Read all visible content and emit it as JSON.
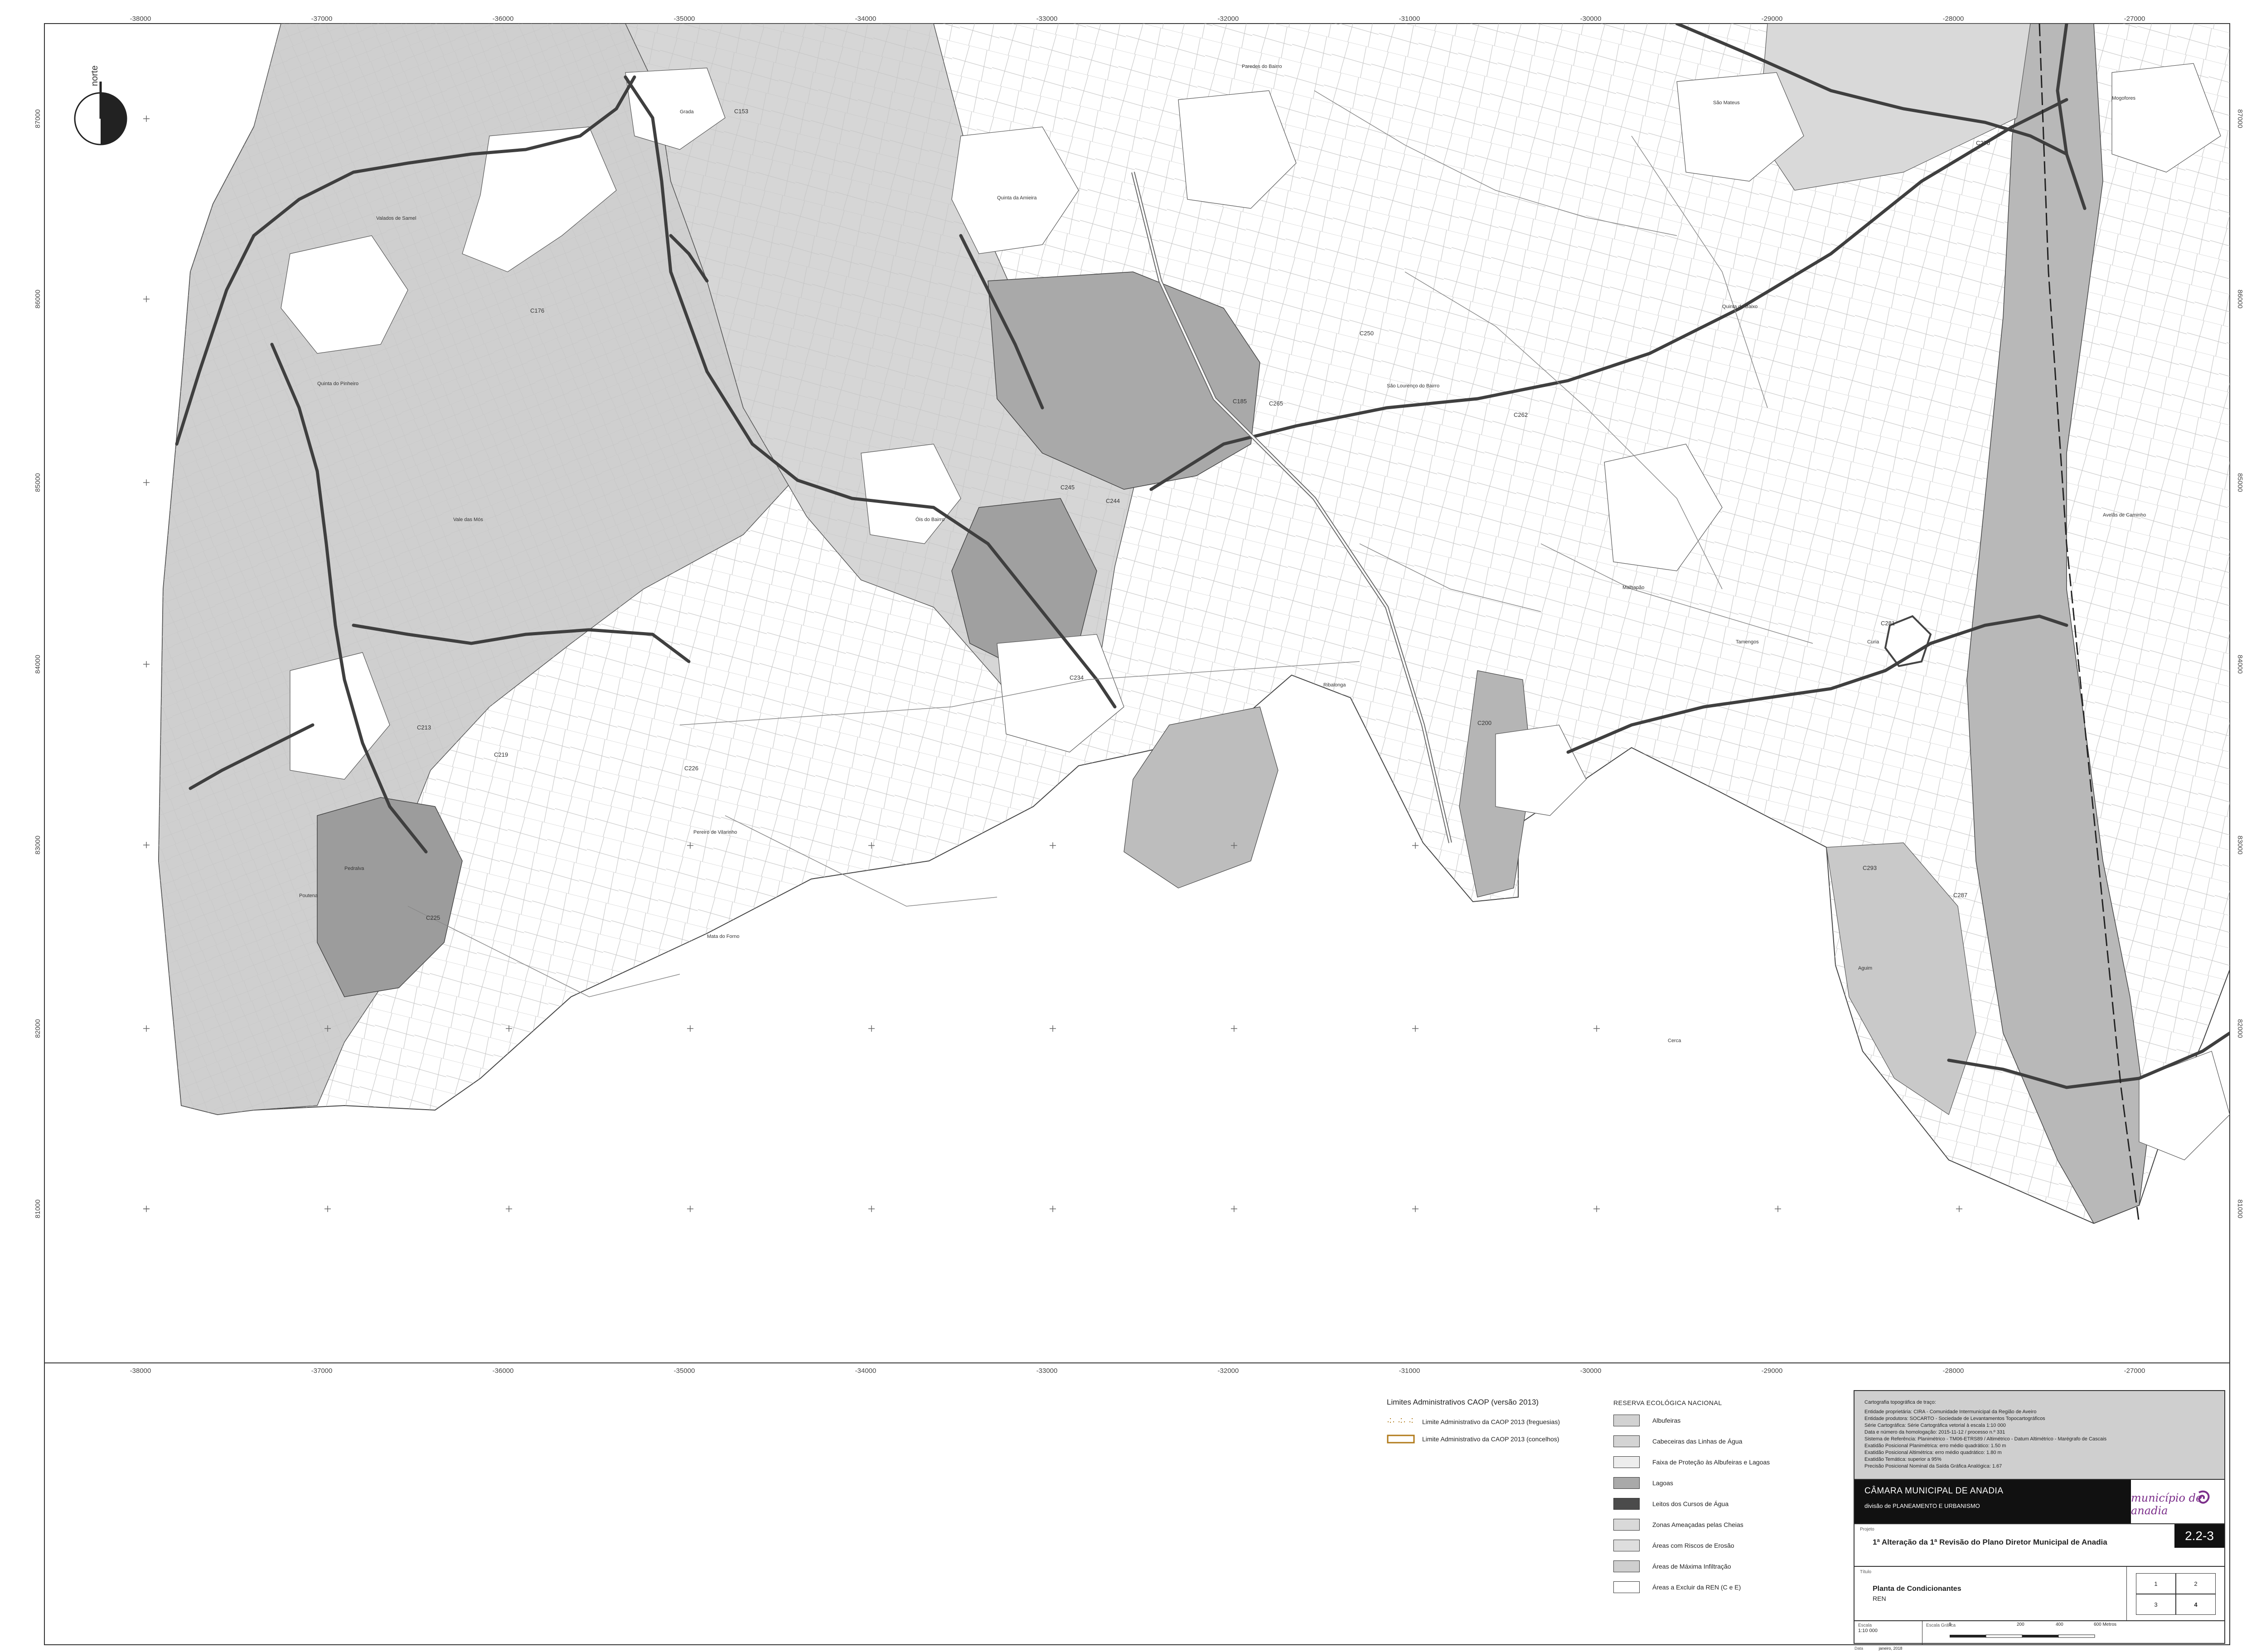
{
  "north_arrow": {
    "label": "norte"
  },
  "axes": {
    "x_ticks": [
      "-38000",
      "-37000",
      "-36000",
      "-35000",
      "-34000",
      "-33000",
      "-32000",
      "-31000",
      "-30000",
      "-29000",
      "-28000",
      "-27000"
    ],
    "y_ticks": [
      "87000",
      "86000",
      "85000",
      "84000",
      "83000",
      "82000",
      "81000"
    ]
  },
  "place_labels": [
    "Valados de Samel",
    "Quinta do Pinheiro",
    "Vale das Mós",
    "Mata do Forno",
    "Pedralva",
    "Óis do Bairro",
    "São Lourenço do Bairro",
    "Ribalonga",
    "Malhapão",
    "Avelãs de Caminho",
    "Mogofores",
    "São Mateus",
    "Grada",
    "Paredes do Bairro",
    "Quinta da Amieira",
    "Cerca",
    "Pereiro de Vilarinho",
    "Poutena",
    "Aguim",
    "Quinta de Baixo",
    "Tamengos",
    "Curia"
  ],
  "feature_codes": [
    "C153",
    "C176",
    "C185",
    "C200",
    "C213",
    "C219",
    "C225",
    "C226",
    "C234",
    "C244",
    "C245",
    "C250",
    "C262",
    "C265",
    "C270",
    "C281",
    "C287",
    "C293"
  ],
  "legend_caop": {
    "title": "Limites Administrativos CAOP (versão 2013)",
    "items": [
      {
        "label": "Limite Administrativo da CAOP 2013 (freguesias)",
        "style": "dashed"
      },
      {
        "label": "Limite Administrativo da CAOP 2013 (concelhos)",
        "style": "double"
      }
    ]
  },
  "legend_ren": {
    "title": "RESERVA ECOLÓGICA NACIONAL",
    "items": [
      {
        "label": "Albufeiras",
        "color": "#d2d2d2"
      },
      {
        "label": "Cabeceiras das Linhas de Água",
        "color": "#d4d4d4"
      },
      {
        "label": "Faixa de Proteção às Albufeiras e Lagoas",
        "color": "#ededed"
      },
      {
        "label": "Lagoas",
        "color": "#a9a9a9"
      },
      {
        "label": "Leitos dos Cursos de Água",
        "color": "#4b4b4b"
      },
      {
        "label": "Zonas Ameaçadas pelas Cheias",
        "color": "#d9d9d9"
      },
      {
        "label": "Áreas com Riscos de Erosão",
        "color": "#dedede"
      },
      {
        "label": "Áreas de Máxima Infiltração",
        "color": "#cfcfcf"
      },
      {
        "label": "Áreas a Excluir da REN (C e E)",
        "color": "#ffffff"
      }
    ]
  },
  "title_block": {
    "credits_heading": "Cartografia topográfica de traço:",
    "credits": [
      "Entidade proprietária: CIRA - Comunidade Intermunicipal da Região de Aveiro",
      "Entidade produtora: SOCARTO - Sociedade de Levantamentos Topocartográficos",
      "Série Cartográfica: Série Cartográfica vetorial à escala 1:10 000",
      "Data e número da homologação: 2015-11-12 / processo n.º 331",
      "Sistema de Referência: Planimétrico - TM06-ETRS89 / Altimétrico - Datum Altimétrico - Marégrafo de Cascais",
      "Exatidão Posicional Planimétrica: erro médio quadrático: 1.50 m",
      "Exatidão Posicional Altimétrica: erro médio quadrático: 1.80 m",
      "Exatidão Temática: superior a 95%",
      "Precisão Posicional Nominal da Saída Gráfica Analógica: 1.67"
    ],
    "org_name": "CÂMARA MUNICIPAL DE ANADIA",
    "division": "divisão de PLANEAMENTO E URBANISMO",
    "logo_text": "município de anadia",
    "project_label": "Projeto",
    "project": "1ª Alteração da 1ª Revisão do Plano Diretor Municipal de Anadia",
    "sheet_number": "2.2-3",
    "title_label": "Título",
    "title": "Planta de Condicionantes",
    "subtitle": "REN",
    "index_sheets": [
      "1",
      "2",
      "3",
      "4"
    ],
    "scale_label": "Escala",
    "scale": "1:10 000",
    "graphic_scale_label": "Escala Gráfica",
    "graphic_scale_ticks": [
      "0",
      "200",
      "400",
      "600 Metros"
    ],
    "date_label": "Data",
    "date": "janeiro, 2018"
  }
}
